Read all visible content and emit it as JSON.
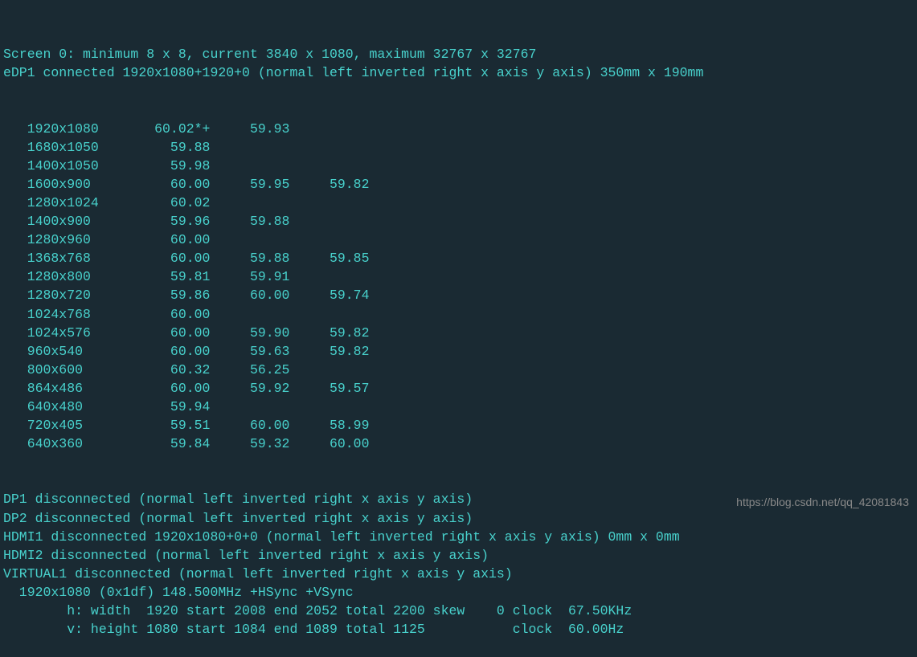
{
  "lines": [
    "Screen 0: minimum 8 x 8, current 3840 x 1080, maximum 32767 x 32767",
    "eDP1 connected 1920x1080+1920+0 (normal left inverted right x axis y axis) 350mm x 190mm"
  ],
  "modes": [
    {
      "res": "1920x1080",
      "rates": [
        "60.02*+",
        "59.93"
      ]
    },
    {
      "res": "1680x1050",
      "rates": [
        "59.88"
      ]
    },
    {
      "res": "1400x1050",
      "rates": [
        "59.98"
      ]
    },
    {
      "res": "1600x900",
      "rates": [
        "60.00",
        "59.95",
        "59.82"
      ]
    },
    {
      "res": "1280x1024",
      "rates": [
        "60.02"
      ]
    },
    {
      "res": "1400x900",
      "rates": [
        "59.96",
        "59.88"
      ]
    },
    {
      "res": "1280x960",
      "rates": [
        "60.00"
      ]
    },
    {
      "res": "1368x768",
      "rates": [
        "60.00",
        "59.88",
        "59.85"
      ]
    },
    {
      "res": "1280x800",
      "rates": [
        "59.81",
        "59.91"
      ]
    },
    {
      "res": "1280x720",
      "rates": [
        "59.86",
        "60.00",
        "59.74"
      ]
    },
    {
      "res": "1024x768",
      "rates": [
        "60.00"
      ]
    },
    {
      "res": "1024x576",
      "rates": [
        "60.00",
        "59.90",
        "59.82"
      ]
    },
    {
      "res": "960x540",
      "rates": [
        "60.00",
        "59.63",
        "59.82"
      ]
    },
    {
      "res": "800x600",
      "rates": [
        "60.32",
        "56.25"
      ]
    },
    {
      "res": "864x486",
      "rates": [
        "60.00",
        "59.92",
        "59.57"
      ]
    },
    {
      "res": "640x480",
      "rates": [
        "59.94"
      ]
    },
    {
      "res": "720x405",
      "rates": [
        "59.51",
        "60.00",
        "58.99"
      ]
    },
    {
      "res": "640x360",
      "rates": [
        "59.84",
        "59.32",
        "60.00"
      ]
    }
  ],
  "trailing": [
    "DP1 disconnected (normal left inverted right x axis y axis)",
    "DP2 disconnected (normal left inverted right x axis y axis)",
    "HDMI1 disconnected 1920x1080+0+0 (normal left inverted right x axis y axis) 0mm x 0mm",
    "HDMI2 disconnected (normal left inverted right x axis y axis)",
    "VIRTUAL1 disconnected (normal left inverted right x axis y axis)",
    "  1920x1080 (0x1df) 148.500MHz +HSync +VSync",
    "        h: width  1920 start 2008 end 2052 total 2200 skew    0 clock  67.50KHz",
    "        v: height 1080 start 1084 end 1089 total 1125           clock  60.00Hz"
  ],
  "watermark": "https://blog.csdn.net/qq_42081843"
}
